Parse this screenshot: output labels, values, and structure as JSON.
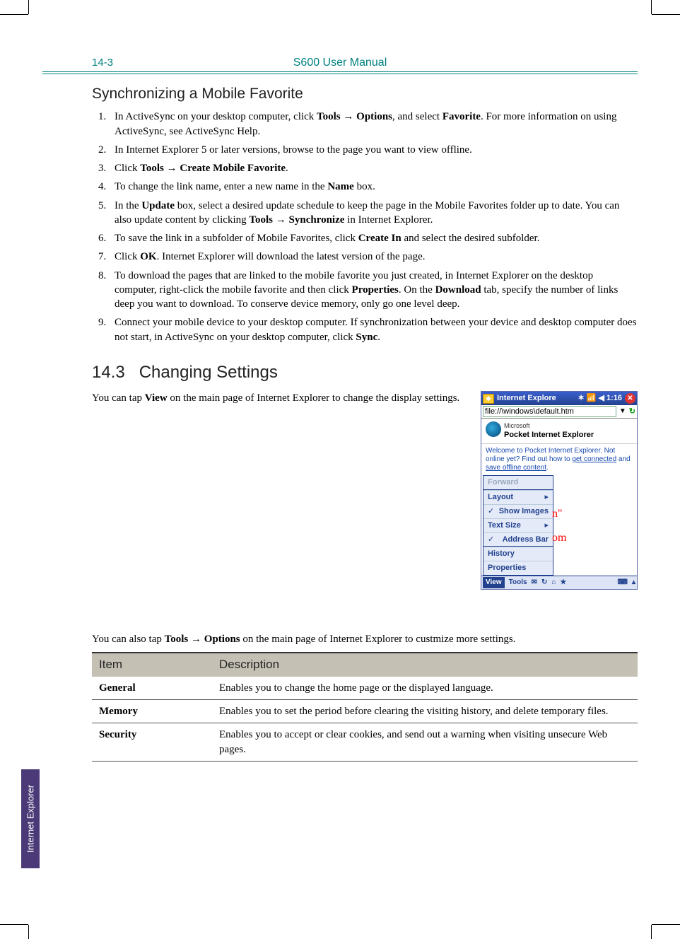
{
  "header": {
    "page_number": "14-3",
    "manual_title": "S600 User Manual"
  },
  "sync_section": {
    "heading": "Synchronizing a Mobile Favorite",
    "steps": [
      {
        "pre": "In ActiveSync on your desktop computer, click ",
        "b1": "Tools → Options",
        "mid": ", and select ",
        "b2": "Favorite",
        "post": ". For more information on using ActiveSync, see ActiveSync Help."
      },
      {
        "pre": "In Internet Explorer 5 or later versions, browse to the page you want to view offline.",
        "b1": "",
        "mid": "",
        "b2": "",
        "post": ""
      },
      {
        "pre": "Click ",
        "b1": "Tools → Create Mobile Favorite",
        "mid": ".",
        "b2": "",
        "post": ""
      },
      {
        "pre": "To change the link name, enter a new name in the ",
        "b1": "Name",
        "mid": " box.",
        "b2": "",
        "post": ""
      },
      {
        "pre": "In the ",
        "b1": "Update",
        "mid": " box, select a desired update schedule to keep the page in the Mobile Favorites folder up to date. You can also update content by clicking ",
        "b2": "Tools → Synchronize",
        "post": " in Internet Explorer."
      },
      {
        "pre": "To save the link in a subfolder of Mobile Favorites, click ",
        "b1": "Create In",
        "mid": " and select the desired subfolder.",
        "b2": "",
        "post": ""
      },
      {
        "pre": "Click ",
        "b1": "OK",
        "mid": ". Internet Explorer will download the latest version of the page.",
        "b2": "",
        "post": ""
      },
      {
        "pre": "To download the pages that are linked to the mobile favorite you just created, in Internet Explorer on the desktop computer, right-click the mobile favorite and then click ",
        "b1": "Properties",
        "mid": ". On the ",
        "b2": "Download",
        "post": " tab, specify the number of links deep you want to download. To conserve device memory, only go one level deep."
      },
      {
        "pre": "Connect your mobile device to your desktop computer. If synchronization between your device and desktop computer does not start, in ActiveSync on your desktop computer, click ",
        "b1": "Sync",
        "mid": ".",
        "b2": "",
        "post": ""
      }
    ]
  },
  "settings_section": {
    "number": "14.3",
    "title": "Changing Settings",
    "intro_pre": "You can tap ",
    "intro_bold": "View",
    "intro_post": " on the main page of Internet Explorer to change the display settings.",
    "options_line_pre": "You can also tap ",
    "options_line_bold": "Tools → Options",
    "options_line_post": " on the main page of Internet Explorer to custmize more settings."
  },
  "screenshot": {
    "titlebar": "Internet Explore",
    "titlebar_icons": "✶  📶 ◀ 1:16",
    "url": "file://\\windows\\default.htm",
    "brand_small": "Microsoft",
    "brand_big": "Pocket Internet Explorer",
    "welcome": "Welcome to Pocket Internet Explorer. Not online yet? Find out how to ",
    "welcome_link1": "get connected",
    "welcome_mid": " and ",
    "welcome_link2": "save offline content",
    "welcome_end": ".",
    "menu": {
      "forward": "Forward",
      "layout": "Layout",
      "show_images": "Show Images",
      "text_size": "Text Size",
      "address_bar": "Address Bar",
      "history": "History",
      "properties": "Properties"
    },
    "overlay1": "n\"",
    "overlay2": "om",
    "bottombar": {
      "view": "View",
      "tools": "Tools"
    }
  },
  "table": {
    "head_item": "Item",
    "head_desc": "Description",
    "rows": [
      {
        "item": "General",
        "desc": "Enables you to change the home page or the displayed language."
      },
      {
        "item": "Memory",
        "desc": "Enables you to set the period before clearing the visiting history, and delete temporary files."
      },
      {
        "item": "Security",
        "desc": "Enables you to accept or clear cookies, and send out a warning when visiting unsecure Web pages."
      }
    ]
  },
  "sidetab": "Internet Explorer"
}
